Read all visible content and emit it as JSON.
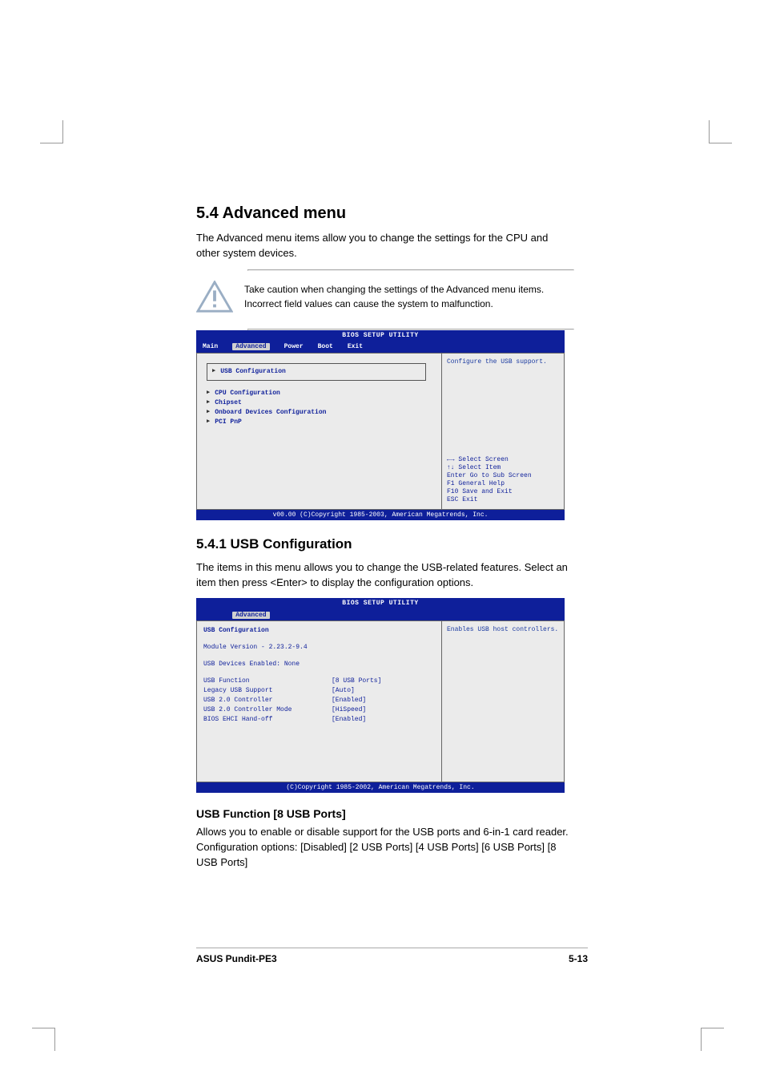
{
  "headings": {
    "h54": "5.4    Advanced menu",
    "h541": "5.4.1   USB Configuration",
    "usb_func_hdr": "USB Function [8 USB Ports]"
  },
  "paras": {
    "adv_intro": "The Advanced menu items allow you to change the settings for the CPU and other system devices.",
    "caution": "Take caution when changing the settings of the Advanced menu items. Incorrect field values can cause the system to malfunction.",
    "usb_intro1": "The items in this menu allows you to change the USB-related features. Select an item then press <Enter> to display the configuration options.",
    "usb_func_body": "Allows you to enable or disable support for the USB ports and 6-in-1 card reader. Configuration options: [Disabled] [2 USB Ports] [4 USB Ports] [6 USB Ports] [8 USB Ports]"
  },
  "bios1": {
    "title": "BIOS SETUP UTILITY",
    "tabs": {
      "main": "Main",
      "advanced": "Advanced",
      "power": "Power",
      "boot": "Boot",
      "exit": "Exit"
    },
    "items": {
      "usb": "USB Configuration",
      "cpu": "CPU Configuration",
      "chipset": "Chipset",
      "onboard": "Onboard Devices Configuration",
      "pci": "PCI PnP"
    },
    "help": "Configure the USB support.",
    "keys": {
      "lr": "←→   Select Screen",
      "ud": "↑↓   Select Item",
      "enter": "Enter Go to Sub Screen",
      "f1": "F1   General Help",
      "f10": "F10  Save and Exit",
      "esc": "ESC  Exit"
    },
    "footer": "v00.00 (C)Copyright 1985-2003, American Megatrends, Inc."
  },
  "bios2": {
    "title": "BIOS SETUP UTILITY",
    "tab": "Advanced",
    "heading": "USB Configuration",
    "module": "Module Version - 2.23.2-9.4",
    "devices": "USB Devices Enabled: None",
    "rows": [
      {
        "k": "USB Function",
        "v": "[8 USB Ports]"
      },
      {
        "k": "Legacy USB Support",
        "v": "[Auto]"
      },
      {
        "k": "USB 2.0 Controller",
        "v": "[Enabled]"
      },
      {
        "k": "USB 2.0 Controller Mode",
        "v": "[HiSpeed]"
      },
      {
        "k": "BIOS EHCI Hand-off",
        "v": "[Enabled]"
      }
    ],
    "help": "Enables USB host controllers.",
    "footer": "(C)Copyright 1985-2002, American Megatrends, Inc."
  },
  "pagefoot": {
    "left": "ASUS Pundit-PE3",
    "right": "5-13"
  }
}
